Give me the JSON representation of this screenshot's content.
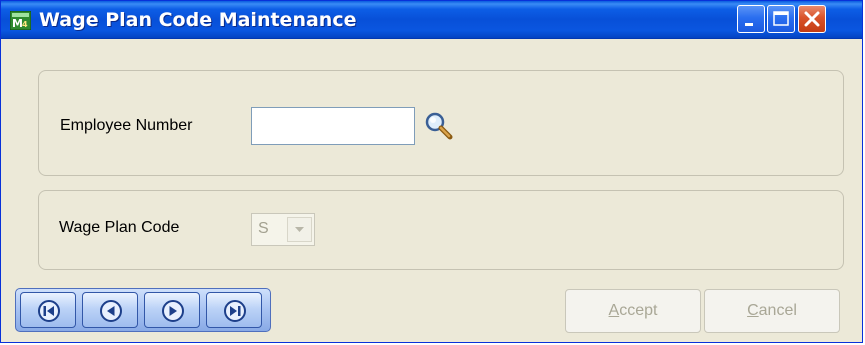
{
  "window": {
    "title": "Wage Plan Code Maintenance",
    "app_icon": "sage-mas-icon"
  },
  "titlebar_buttons": {
    "minimize": "minimize-icon",
    "maximize": "maximize-icon",
    "close": "close-icon"
  },
  "employee": {
    "label": "Employee Number",
    "value": "",
    "lookup_icon": "magnifier-icon"
  },
  "wage_plan": {
    "label": "Wage Plan Code",
    "selected": "S",
    "enabled": false
  },
  "navigation": {
    "buttons": [
      "first-record",
      "previous-record",
      "next-record",
      "last-record"
    ]
  },
  "actions": {
    "accept_hotkey": "A",
    "accept_rest": "ccept",
    "cancel_hotkey": "C",
    "cancel_rest": "ancel",
    "enabled": false
  },
  "colors": {
    "titlebar": "#0850d8",
    "window_bg": "#ece9d8",
    "close_button": "#d9532a",
    "disabled_text": "#a9a796"
  }
}
